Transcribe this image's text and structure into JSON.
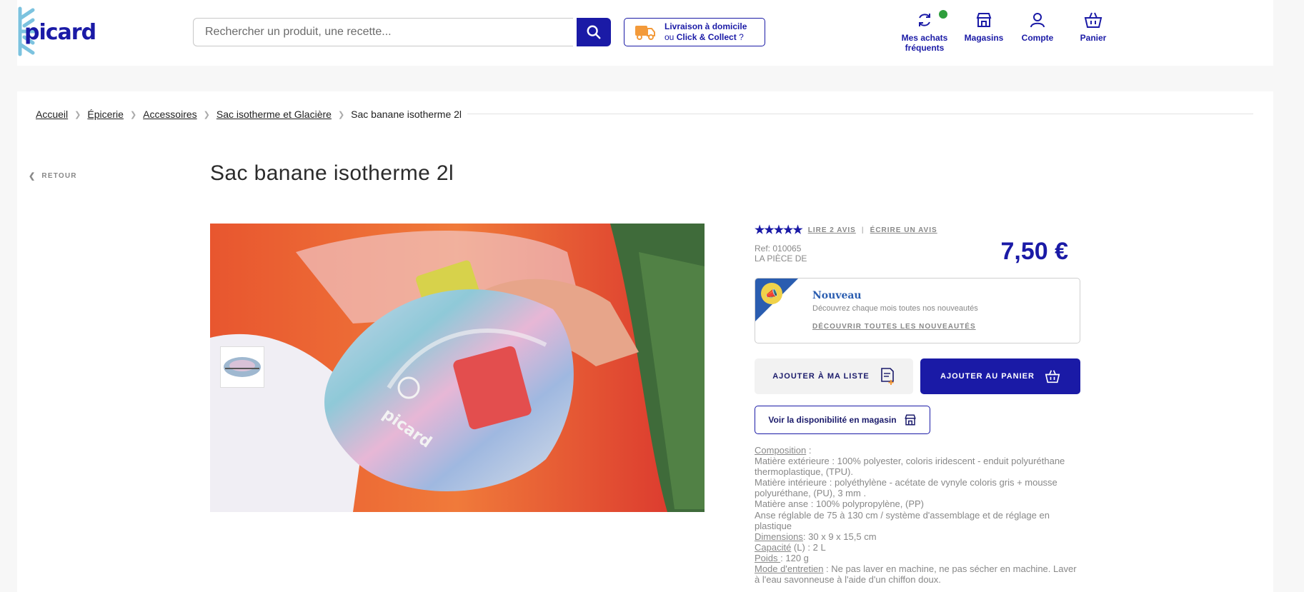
{
  "header": {
    "logo_text": "picard",
    "search_placeholder": "Rechercher un produit, une recette...",
    "delivery_line1": "Livraison à domicile",
    "delivery_or": "ou",
    "delivery_cc": "Click & Collect",
    "delivery_q": "?",
    "nav": [
      {
        "label": "Mes achats fréquents",
        "icon": "refresh-icon"
      },
      {
        "label": "Magasins",
        "icon": "store-icon"
      },
      {
        "label": "Compte",
        "icon": "user-icon"
      },
      {
        "label": "Panier",
        "icon": "basket-icon"
      }
    ]
  },
  "breadcrumb": [
    "Accueil",
    "Épicerie",
    "Accessoires",
    "Sac isotherme et Glacière",
    "Sac banane isotherme 2l"
  ],
  "back_label": "RETOUR",
  "product": {
    "title": "Sac banane isotherme 2l",
    "rating": 5,
    "read_reviews": "LIRE 2 AVIS",
    "rating_sep": "|",
    "write_review": "ÉCRIRE UN AVIS",
    "ref": "Ref: 010065",
    "unit": "LA PIÈCE DE",
    "price": "7,50 €",
    "promo": {
      "title": "Nouveau",
      "subtitle": "Découvrez chaque mois toutes nos nouveautés",
      "link": "DÉCOUVRIR TOUTES LES NOUVEAUTÉS"
    },
    "add_list_label": "AJOUTER À MA LISTE",
    "add_cart_label": "AJOUTER AU PANIER",
    "stock_label": "Voir la disponibilité en magasin",
    "image_brand": "picard",
    "description": {
      "composition_label": "Composition",
      "composition_sep": " :",
      "lines": [
        "Matière extérieure : 100% polyester, coloris iridescent - enduit polyuréthane thermoplastique, (TPU).",
        "Matière intérieure : polyéthylène - acétate de vynyle coloris gris + mousse polyuréthane, (PU), 3 mm .",
        "Matière anse : 100% polypropylène, (PP)",
        "Anse réglable de 75 à 130 cm / système d'assemblage et de réglage en plastique"
      ],
      "dimensions_label": "Dimensions",
      "dimensions_value": ": 30 x 9 x 15,5 cm",
      "capacity_label": "Capacité",
      "capacity_value": " (L) : 2 L",
      "weight_label": "Poids ",
      "weight_value": ": 120 g",
      "care_label": "Mode d'entretien",
      "care_value": " : Ne pas laver en machine, ne pas sécher en machine. Laver à l'eau savonneuse à l'aide d'un chiffon doux."
    }
  },
  "colors": {
    "brand": "#1a1aa6",
    "accent_blue": "#2a5db0",
    "notify_green": "#2e9e3c"
  }
}
